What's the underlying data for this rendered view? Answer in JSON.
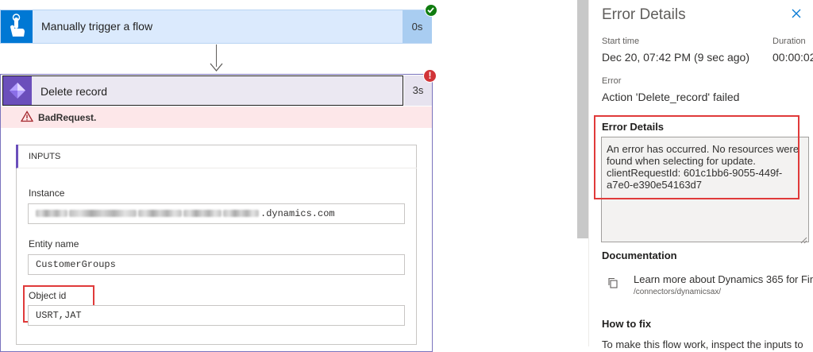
{
  "trigger": {
    "title": "Manually trigger a flow",
    "duration": "0s"
  },
  "action": {
    "title": "Delete record",
    "duration": "3s",
    "error": "BadRequest."
  },
  "inputs": {
    "header": "INPUTS",
    "instance_label": "Instance",
    "instance_value": ".dynamics.com",
    "entity_label": "Entity name",
    "entity_value": "CustomerGroups",
    "object_label": "Object id",
    "object_value": "USRT,JAT"
  },
  "panel": {
    "title": "Error Details",
    "start_label": "Start time",
    "start_value": "Dec 20, 07:42 PM (9 sec ago)",
    "duration_label": "Duration",
    "duration_value": "00:00:02",
    "error_label": "Error",
    "error_value": "Action 'Delete_record' failed",
    "details_heading": "Error Details",
    "details_text": "An error has occurred.  No resources were found when selecting for update. clientRequestId: 601c1bb6-9055-449f-a7e0-e390e54163d7",
    "doc_heading": "Documentation",
    "doc_link": "Learn more about Dynamics 365 for Fin",
    "doc_sub": "/connectors/dynamicsax/",
    "fix_heading": "How to fix",
    "fix_text": "To make this flow work, inspect the inputs to"
  },
  "colors": {
    "accent": "#0078d4",
    "action_purple": "#6b4fbb",
    "error_red": "#d13438",
    "success_green": "#107c10",
    "highlight_red": "#e03a3a"
  },
  "icons": [
    "touch-icon",
    "check-badge-icon",
    "arrow-down-icon",
    "dataverse-icon",
    "error-badge-icon",
    "warning-icon",
    "close-icon",
    "copy-icon",
    "resize-grip-icon"
  ]
}
